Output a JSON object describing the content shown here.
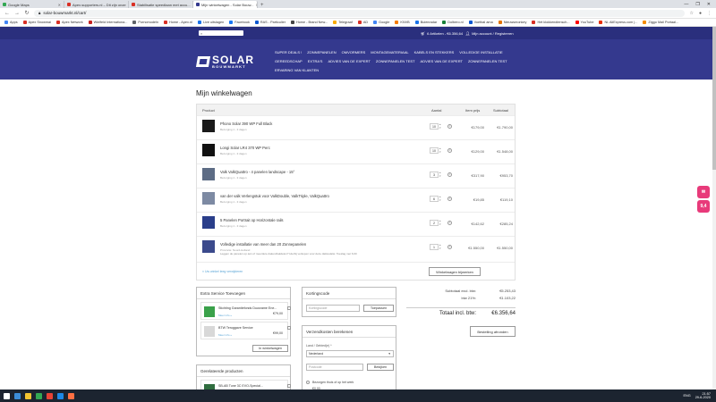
{
  "browser": {
    "tabs": [
      {
        "label": "Google Maps",
        "color": "#34a853",
        "active": false
      },
      {
        "label": "Apex.supporters.nl – Dit zijn onze",
        "color": "#d93025",
        "active": false
      },
      {
        "label": "Stabilisatie speedlaan met accu...",
        "color": "#d93025",
        "active": false
      },
      {
        "label": "Mijn winkelwagen - Solar Bouw...",
        "color": "#34398e",
        "active": true
      }
    ],
    "new_tab": "+",
    "url": "solar-bouwmarkt.nl/cart/",
    "window_controls": [
      "—",
      "❐",
      "✕"
    ],
    "bookmarks": [
      {
        "label": "Apps",
        "color": "#4285f4"
      },
      {
        "label": "Apex Snowmai",
        "color": "#d93025"
      },
      {
        "label": "Apex Network",
        "color": "#d93025"
      },
      {
        "label": "Wielfeld Internationa...",
        "color": "#c5221f"
      },
      {
        "label": "Pornomodeln",
        "color": "#5f6368"
      },
      {
        "label": "Home - Apex.nl",
        "color": "#d93025"
      },
      {
        "label": "Live uitslagen",
        "color": "#1a73e8"
      },
      {
        "label": "Facebook",
        "color": "#1877f2"
      },
      {
        "label": "RAS - Particulier",
        "color": "#0b57d0"
      },
      {
        "label": "Home - Brand New...",
        "color": "#444"
      },
      {
        "label": "Telegraaf",
        "color": "#f9ab00"
      },
      {
        "label": "AD",
        "color": "#d93025"
      },
      {
        "label": "Google",
        "color": "#4285f4"
      },
      {
        "label": "KNVB",
        "color": "#f57c00"
      },
      {
        "label": "Buienradar",
        "color": "#1a73e8"
      },
      {
        "label": "Dolbero.nl",
        "color": "#188038"
      },
      {
        "label": "Voetbal ama",
        "color": "#0b57d0"
      },
      {
        "label": "Nieuwsmonkey",
        "color": "#e37400"
      },
      {
        "label": "Het klokkendiensch...",
        "color": "#d93025"
      },
      {
        "label": "YouTube",
        "color": "#ff0000"
      },
      {
        "label": "NL AliExpress.com |...",
        "color": "#e62e04"
      },
      {
        "label": "Ziggo Mail Portaal...",
        "color": "#f48c00"
      }
    ]
  },
  "site": {
    "search_placeholder": "",
    "cart_summary": "6 Artikelen - €6.356,64",
    "account": "Mijn account / Registreren",
    "logo_line1": "SOLAR",
    "logo_line2": "BOUWMARKT",
    "nav": [
      "SUPER DEALS !",
      "ZONNEPANELEN",
      "OMVORMERS",
      "MONTAGEMATERIAAL",
      "KABELS EN STEKKERS",
      "VOLLEDIGE INSTALLATIE",
      "GEREEDSCHAP",
      "EXTRA'S",
      "ADVIES VAN DE EXPERT",
      "ZONNEPANELEN TEST",
      "ADVIES VAN DE EXPERT",
      "ZONNEPANELEN TEST",
      "ERVARING VAN KLANTEN"
    ]
  },
  "page": {
    "title": "Mijn winkelwagen"
  },
  "cart": {
    "headers": {
      "product": "Product",
      "qty": "Aantal",
      "price": "Item prijs",
      "subtotal": "Subtotaal"
    },
    "items": [
      {
        "name": "Phono Solar 390 WP Full Black",
        "sub": "Bezorging 1 - 3 dagen",
        "qty": "10",
        "price": "€179,00",
        "subtotal": "€1.790,00",
        "thumb": "#1a1a1a"
      },
      {
        "name": "Longi Solar LR4 370 WP Perc",
        "sub": "Bezorging 1 - 3 dagen",
        "qty": "10",
        "price": "€129,00",
        "subtotal": "€1.548,00",
        "thumb": "#111111"
      },
      {
        "name": "Valk ValkQuattro - 4 panelen landscape - 15°",
        "sub": "Bezorging 1 - 3 dagen",
        "qty": "3",
        "price": "€317,90",
        "subtotal": "€953,70",
        "thumb": "#5d6c85"
      },
      {
        "name": "van der valk Verlengstuk voor ValkDouble, ValkTriple, ValkQuattro",
        "sub": "Bezorging 1 - 3 dagen",
        "qty": "6",
        "price": "€19,85",
        "subtotal": "€119,10",
        "thumb": "#7d8aa3"
      },
      {
        "name": "5 Panelen Portrait op Horizontale rails",
        "sub": "Bezorging 1 - 3 dagen",
        "qty": "2",
        "price": "€142,62",
        "subtotal": "€285,24",
        "thumb": "#2a3e8a"
      },
      {
        "name": "Volledige installatie van meer dan 20 Zonnepanelen",
        "sub": "Provincie: Noord-Holland",
        "note": "Leggen de panelen op één of meerdere daken/dakdelen? Hierbij verkopen voor deze daktoelatie: Toeslag met 6,00",
        "qty": "1",
        "price": "€1.550,00",
        "subtotal": "€1.550,00",
        "thumb": "#3b4a8c"
      }
    ],
    "clear": "× Uw winkel leeg verwijderen",
    "update": "Winkelwagen bijwerken"
  },
  "extra_services": {
    "title": "Extra Service Toevoegen",
    "items": [
      {
        "name": "Stichting Garantiefonds Duurzame Ene...",
        "meta": "Meer info »",
        "price": "€79,00",
        "thumb": "#3aa14a"
      },
      {
        "name": "BTW Teruggave Service",
        "meta": "Meer info »",
        "price": "€99,00",
        "thumb": "#d8d8d8"
      }
    ],
    "button": "In winkelwagen"
  },
  "related": {
    "title": "Gerelateerde producten",
    "items": [
      {
        "name": "SB-AB Tune 3C EVO-Special...",
        "thumb": "#2f6d3f"
      }
    ]
  },
  "coupon": {
    "title": "Kortingscode",
    "placeholder": "Kortingscode",
    "button": "Toepassen"
  },
  "shipping": {
    "title": "Verzendkosten berekenen",
    "country_label": "Land / Gebied(e) *",
    "country_value": "Nederland",
    "postcode_placeholder": "Postcode",
    "button": "Bekijken",
    "option_label": "Bezorgen thuis of op het werk",
    "option_price": "€0,00"
  },
  "totals": {
    "subtotal_label": "Subtotaal excl. btw:",
    "subtotal_value": "€5.253,43",
    "vat_label": "btw 21%:",
    "vat_value": "€1.103,22",
    "total_label": "Totaal incl. btw:",
    "total_value": "€6.356,64",
    "checkout": "Bestelling afronden"
  },
  "badges": {
    "chat": "✉",
    "rating": "9,4"
  },
  "taskbar": {
    "icons": [
      "#ffffff",
      "#3c8dd8",
      "#f4c430",
      "#34a853",
      "#ea4335",
      "#1e88e5",
      "#ff7043"
    ],
    "tray": "ENG",
    "time": "21:57",
    "date": "29-6-2020"
  }
}
